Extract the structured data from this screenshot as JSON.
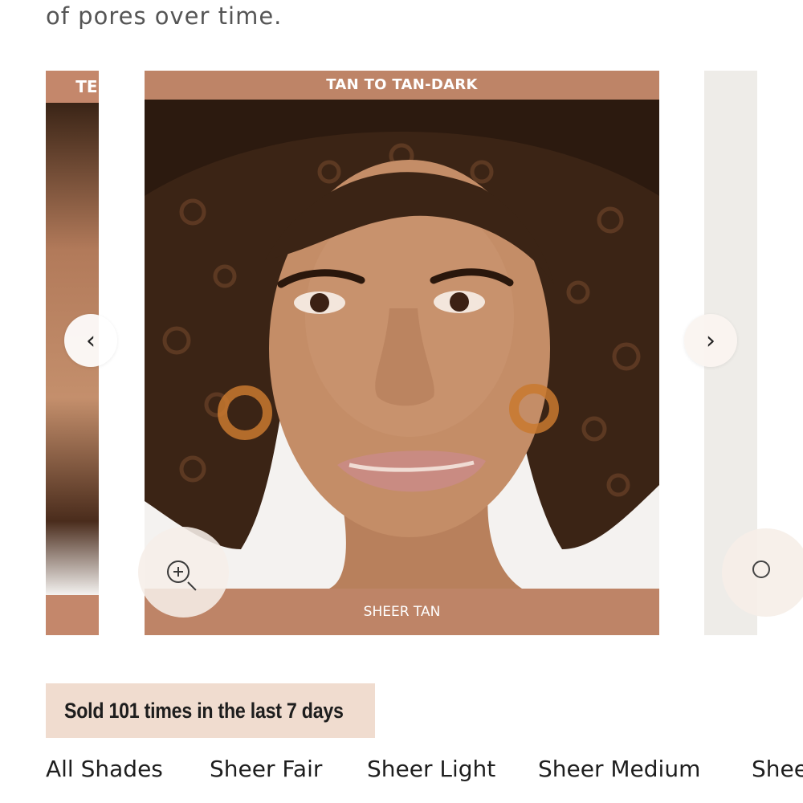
{
  "description": {
    "text_line_partial": "of pores over time."
  },
  "carousel": {
    "left_slide_label": "TER",
    "main_slide_top_label": "TAN TO TAN-DARK",
    "main_slide_bottom_label": "SHEER TAN",
    "prev_label": "‹",
    "next_label": "›",
    "zoom_icon": "zoom-in-icon"
  },
  "sales_badge": {
    "text": "Sold 101 times in the last 7 days"
  },
  "shade_tabs": [
    "All Shades",
    "Sheer Fair",
    "Sheer Light",
    "Sheer Medium",
    "Shee"
  ],
  "colors": {
    "band": "#be8467",
    "badge": "#f0dccf"
  }
}
